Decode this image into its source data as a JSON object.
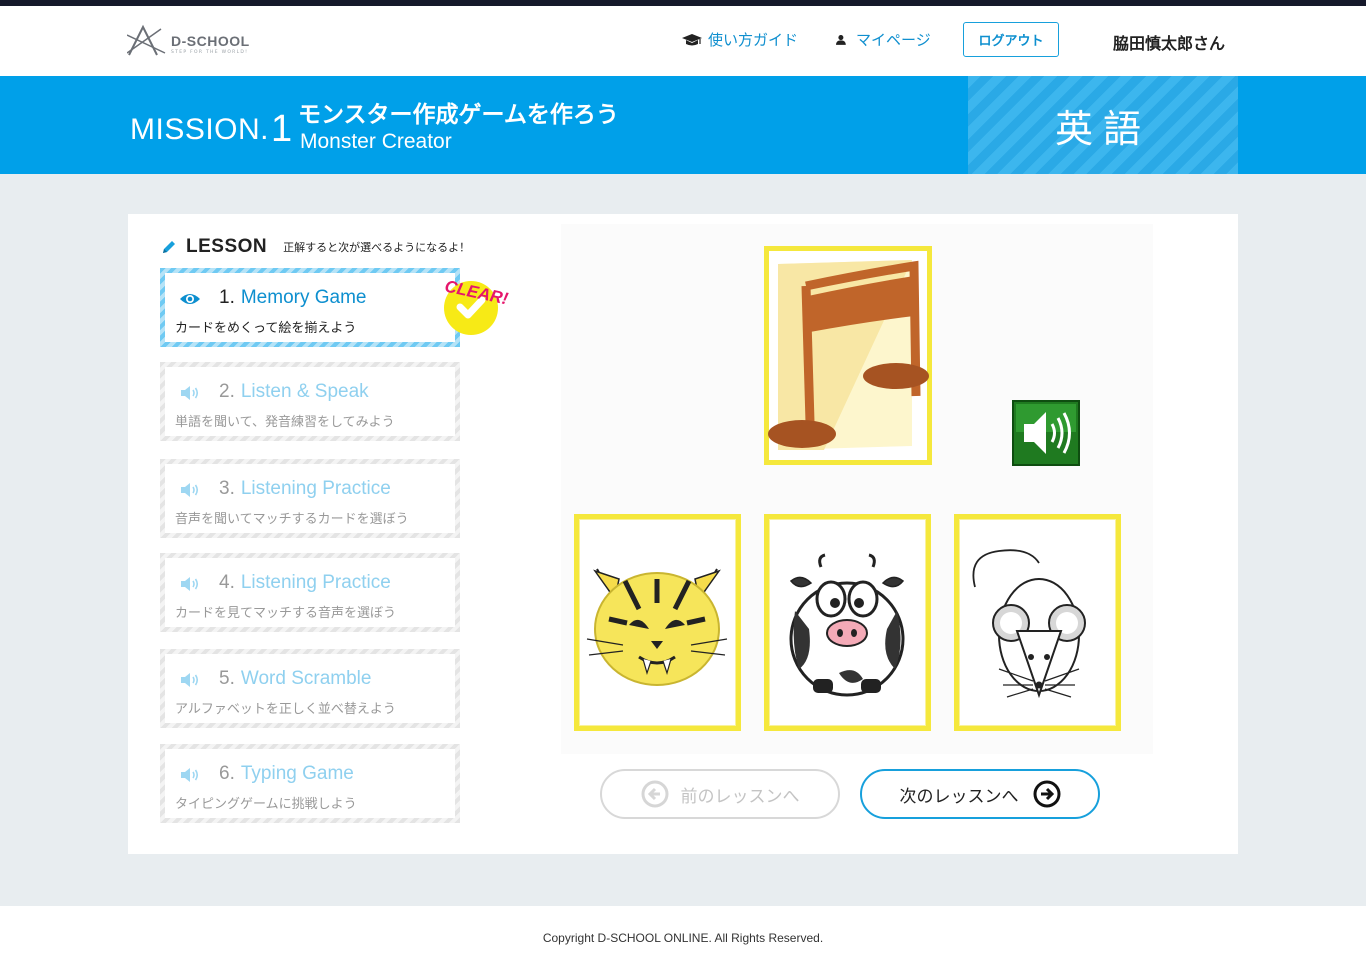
{
  "header": {
    "logo_text": "D-SCHOOL",
    "logo_tagline": "STEP FOR THE WORLD!",
    "nav": [
      {
        "label": "使い方ガイド",
        "icon": "graduation-cap-icon"
      },
      {
        "label": "マイページ",
        "icon": "user-icon"
      }
    ],
    "logout_label": "ログアウト",
    "username": "脇田慎太郎さん"
  },
  "mission": {
    "prefix": "MISSION.",
    "number": "1",
    "title": "モンスター作成ゲームを作ろう",
    "subtitle": "Monster Creator",
    "subject": "英語"
  },
  "lesson_panel": {
    "heading": "LESSON",
    "hint": "正解すると次が選べるようになるよ！",
    "clear_badge": "CLEAR!",
    "lessons": [
      {
        "num": "1.",
        "title": "Memory Game",
        "desc": "カードをめくって絵を揃えよう",
        "icon": "eye-icon",
        "state": "active",
        "cleared": true
      },
      {
        "num": "2.",
        "title": "Listen & Speak",
        "desc": "単語を聞いて、発音練習をしてみよう",
        "icon": "speaker-icon",
        "state": "locked"
      },
      {
        "num": "3.",
        "title": "Listening Practice",
        "desc": "音声を聞いてマッチするカードを選ぼう",
        "icon": "speaker-icon",
        "state": "locked"
      },
      {
        "num": "4.",
        "title": "Listening Practice",
        "desc": "カードを見てマッチする音声を選ぼう",
        "icon": "speaker-icon",
        "state": "locked"
      },
      {
        "num": "5.",
        "title": "Word Scramble",
        "desc": "アルファベットを正しく並べ替えよう",
        "icon": "speaker-icon",
        "state": "locked"
      },
      {
        "num": "6.",
        "title": "Typing Game",
        "desc": "タイピングゲームに挑戦しよう",
        "icon": "speaker-icon",
        "state": "locked"
      }
    ]
  },
  "game": {
    "question_card": "music-note-icon",
    "sound_button": "speaker-icon",
    "choices": [
      "tiger",
      "cow",
      "mouse"
    ]
  },
  "buttons": {
    "prev_label": "前のレッスンへ",
    "next_label": "次のレッスンへ"
  },
  "footer": {
    "copyright": "Copyright D-SCHOOL ONLINE. All Rights Reserved."
  },
  "colors": {
    "accent": "#00a0e9",
    "header_dark": "#15192a",
    "card_border": "#f5e83c",
    "badge_yellow": "#f7ea16",
    "badge_pink": "#e5166b"
  }
}
